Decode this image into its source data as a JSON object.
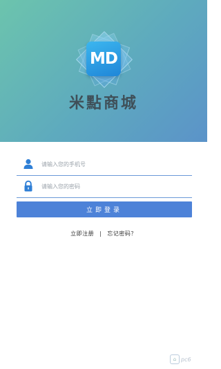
{
  "header": {
    "logo_text": "MD",
    "brand_name": "米點商城"
  },
  "form": {
    "phone_placeholder": "请输入您的手机号",
    "password_placeholder": "请输入您的密码",
    "phone_icon": "user-icon",
    "password_icon": "lock-icon",
    "login_label": "立即登录"
  },
  "links": {
    "register_label": "立即注册",
    "separator": "|",
    "forgot_label": "忘记密码？"
  },
  "watermark": {
    "text": "pc6"
  },
  "colors": {
    "hero_gradient_start": "#6cc4ad",
    "hero_gradient_end": "#5b93c9",
    "accent": "#4d82d8",
    "logo_tile": "#2a9be3"
  }
}
